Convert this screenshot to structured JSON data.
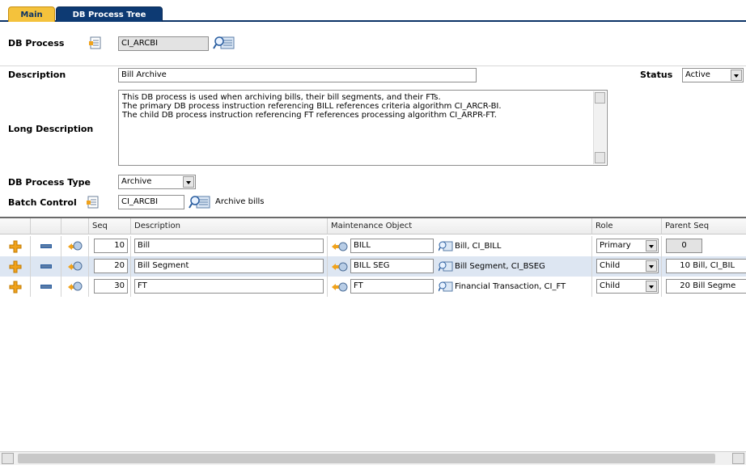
{
  "tabs": [
    {
      "label": "Main"
    },
    {
      "label": "DB Process Tree"
    }
  ],
  "db_process": {
    "label": "DB Process",
    "value": "CI_ARCBI"
  },
  "description": {
    "label": "Description",
    "value": "Bill Archive"
  },
  "status": {
    "label": "Status",
    "value": "Active"
  },
  "long_description": {
    "label": "Long Description",
    "lines": [
      "This DB process is used when archiving bills, their bill segments, and their FTs.",
      "The primary DB process instruction referencing BILL references criteria algorithm CI_ARCR-BI.",
      "The child DB process instruction referencing FT references processing algorithm CI_ARPR-FT."
    ]
  },
  "process_type": {
    "label": "DB Process Type",
    "value": "Archive"
  },
  "batch_control": {
    "label": "Batch Control",
    "value": "CI_ARCBI",
    "description": "Archive bills"
  },
  "grid": {
    "headers": {
      "seq": "Seq",
      "description": "Description",
      "maintenance_object": "Maintenance Object",
      "role": "Role",
      "parent_seq": "Parent Seq"
    },
    "rows": [
      {
        "seq": "10",
        "description": "Bill",
        "mo": "BILL",
        "mo_desc": "Bill, CI_BILL",
        "role": "Primary",
        "parent_seq": "0",
        "parent_desc": ""
      },
      {
        "seq": "20",
        "description": "Bill Segment",
        "mo": "BILL SEG",
        "mo_desc": "Bill Segment, CI_BSEG",
        "role": "Child",
        "parent_seq": "10",
        "parent_desc": "Bill, CI_BIL"
      },
      {
        "seq": "30",
        "description": "FT",
        "mo": "FT",
        "mo_desc": "Financial Transaction, CI_FT",
        "role": "Child",
        "parent_seq": "20",
        "parent_desc": "Bill Segme"
      }
    ]
  },
  "icons": {
    "add": "add-row-icon",
    "remove": "remove-row-icon",
    "goto": "goto-icon",
    "search": "search-icon",
    "context": "context-menu-icon"
  },
  "colors": {
    "tab_active": "#0d3a73",
    "tab_inactive": "#f4c23c",
    "row_alt": "#dde6f2"
  }
}
